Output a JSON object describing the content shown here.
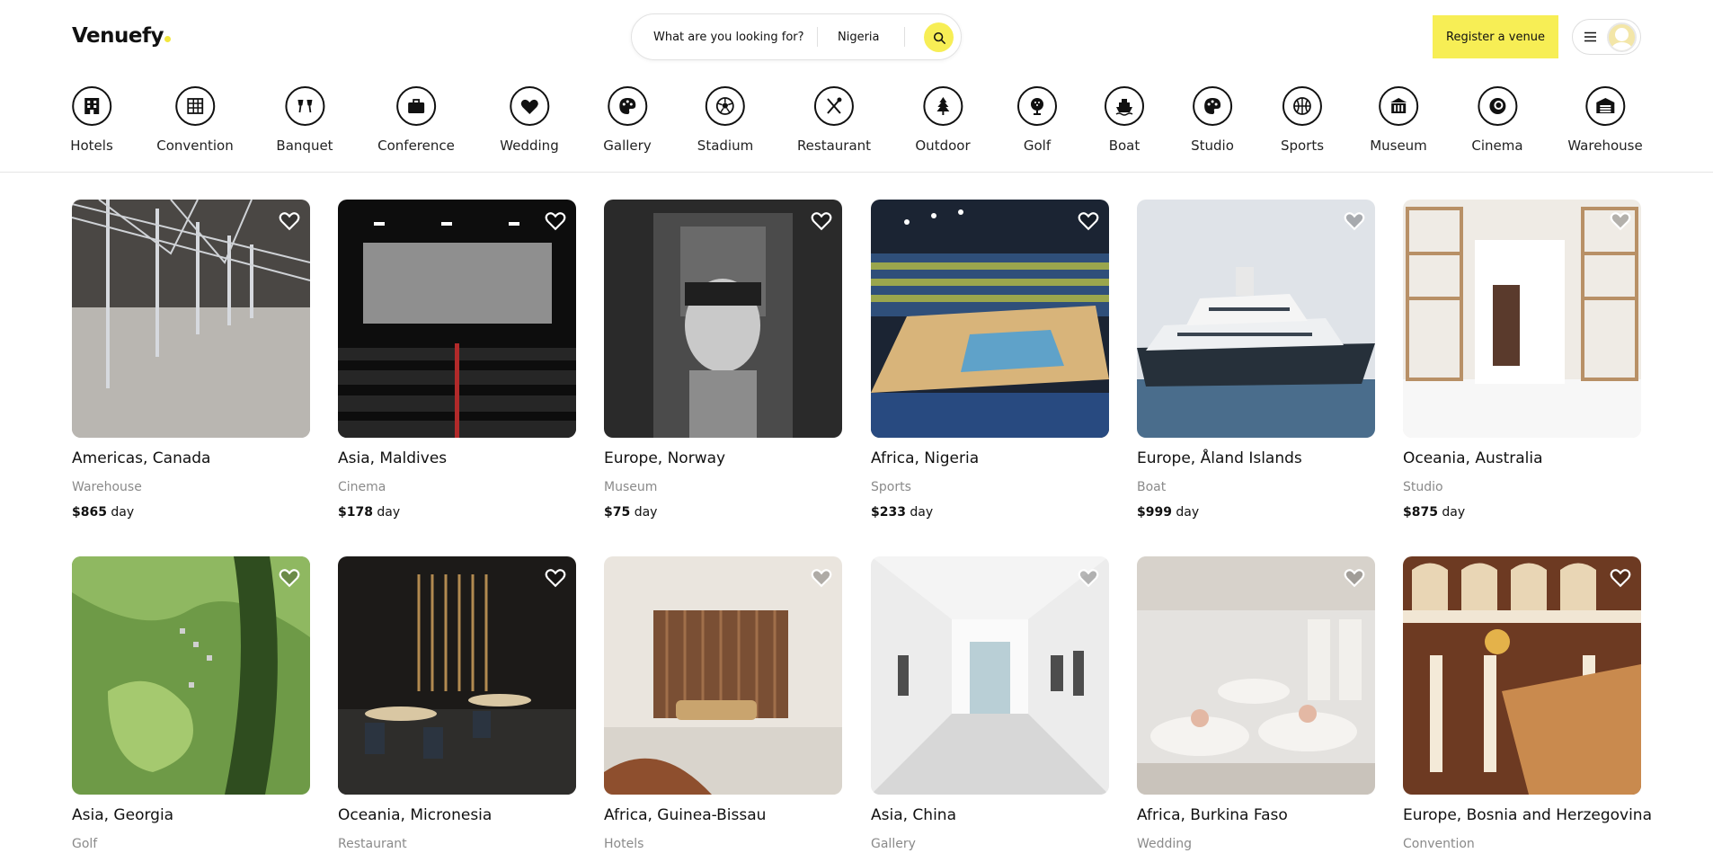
{
  "header": {
    "logo": "Venuefy",
    "search_what": "What are you looking for?",
    "search_location": "Nigeria",
    "register_label": "Register a venue"
  },
  "categories": [
    {
      "label": "Hotels",
      "icon": "hotel-icon"
    },
    {
      "label": "Convention",
      "icon": "convention-icon"
    },
    {
      "label": "Banquet",
      "icon": "banquet-icon"
    },
    {
      "label": "Conference",
      "icon": "briefcase-icon"
    },
    {
      "label": "Wedding",
      "icon": "heart-icon"
    },
    {
      "label": "Gallery",
      "icon": "palette-icon"
    },
    {
      "label": "Stadium",
      "icon": "soccer-ball-icon"
    },
    {
      "label": "Restaurant",
      "icon": "utensils-icon"
    },
    {
      "label": "Outdoor",
      "icon": "tree-icon"
    },
    {
      "label": "Golf",
      "icon": "golf-icon"
    },
    {
      "label": "Boat",
      "icon": "boat-icon"
    },
    {
      "label": "Studio",
      "icon": "palette-icon"
    },
    {
      "label": "Sports",
      "icon": "basketball-icon"
    },
    {
      "label": "Museum",
      "icon": "museum-icon"
    },
    {
      "label": "Cinema",
      "icon": "cinema-icon"
    },
    {
      "label": "Warehouse",
      "icon": "warehouse-icon"
    }
  ],
  "listings": [
    {
      "title": "Americas, Canada",
      "type": "Warehouse",
      "price": "$865",
      "unit": "day"
    },
    {
      "title": "Asia, Maldives",
      "type": "Cinema",
      "price": "$178",
      "unit": "day"
    },
    {
      "title": "Europe, Norway",
      "type": "Museum",
      "price": "$75",
      "unit": "day"
    },
    {
      "title": "Africa, Nigeria",
      "type": "Sports",
      "price": "$233",
      "unit": "day"
    },
    {
      "title": "Europe, Åland Islands",
      "type": "Boat",
      "price": "$999",
      "unit": "day"
    },
    {
      "title": "Oceania, Australia",
      "type": "Studio",
      "price": "$875",
      "unit": "day"
    },
    {
      "title": "Asia, Georgia",
      "type": "Golf"
    },
    {
      "title": "Oceania, Micronesia",
      "type": "Restaurant"
    },
    {
      "title": "Africa, Guinea-Bissau",
      "type": "Hotels"
    },
    {
      "title": "Asia, China",
      "type": "Gallery"
    },
    {
      "title": "Africa, Burkina Faso",
      "type": "Wedding"
    },
    {
      "title": "Europe, Bosnia and Herzegovina",
      "type": "Convention"
    }
  ],
  "colors": {
    "accent": "#f7ee55",
    "muted_text": "#8a8a8a"
  }
}
